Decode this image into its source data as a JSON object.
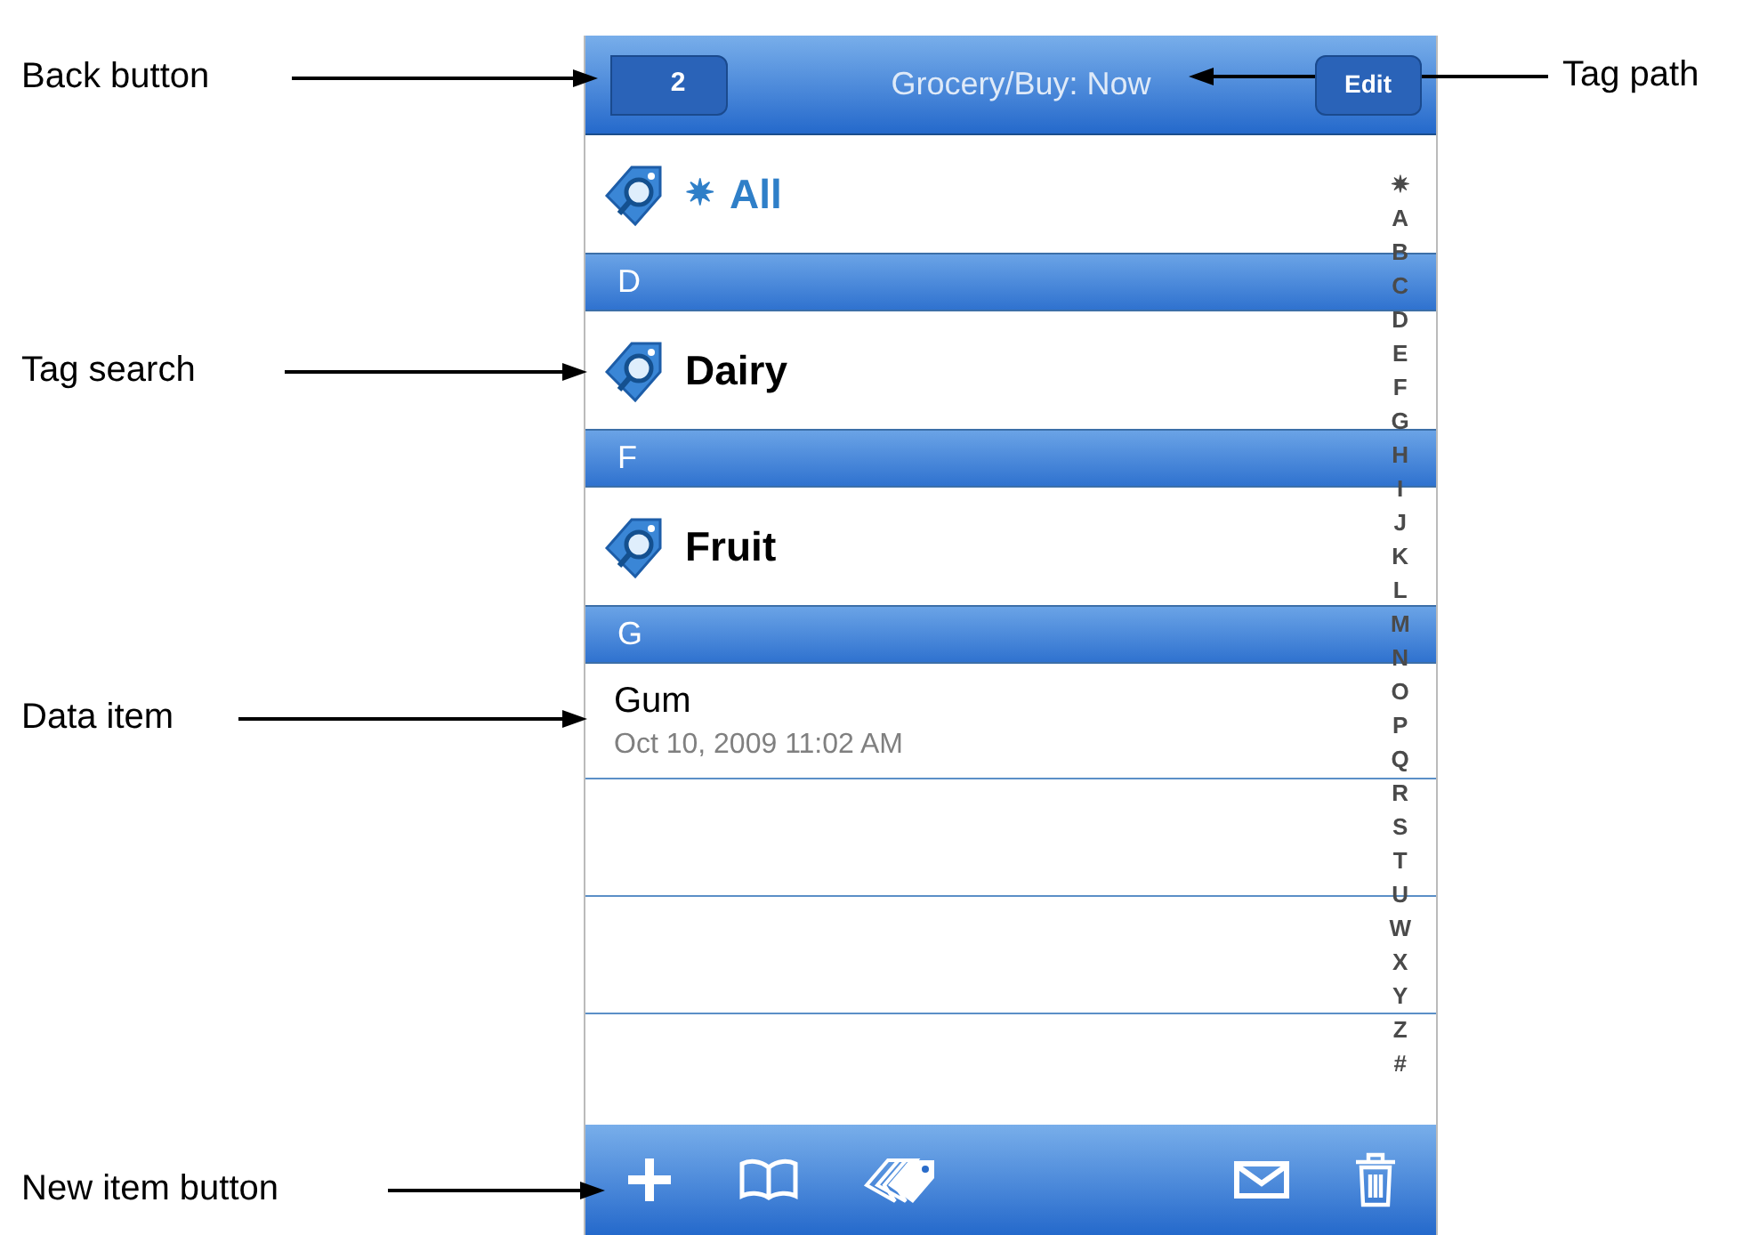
{
  "nav": {
    "back": "2",
    "title": "Grocery/Buy: Now",
    "edit": "Edit"
  },
  "rows": [
    {
      "kind": "tag",
      "prefix": "✷",
      "label": "All",
      "color": "#2f7fc8"
    },
    {
      "kind": "header",
      "label": "D"
    },
    {
      "kind": "tag",
      "label": "Dairy",
      "color": "#000000"
    },
    {
      "kind": "header",
      "label": "F"
    },
    {
      "kind": "tag",
      "label": "Fruit",
      "color": "#000000"
    },
    {
      "kind": "header",
      "label": "G"
    },
    {
      "kind": "item",
      "label": "Gum",
      "date": "Oct 10, 2009 11:02 AM"
    },
    {
      "kind": "empty"
    },
    {
      "kind": "empty"
    },
    {
      "kind": "empty"
    }
  ],
  "index": [
    "✷",
    "A",
    "B",
    "C",
    "D",
    "E",
    "F",
    "G",
    "H",
    "I",
    "J",
    "K",
    "L",
    "M",
    "N",
    "O",
    "P",
    "Q",
    "R",
    "S",
    "T",
    "U",
    "W",
    "X",
    "Y",
    "Z",
    "#"
  ],
  "annotations": [
    {
      "label": "Back button"
    },
    {
      "label": "Tag path"
    },
    {
      "label": "Tag search"
    },
    {
      "label": "Data item"
    },
    {
      "label": "New item button"
    }
  ]
}
